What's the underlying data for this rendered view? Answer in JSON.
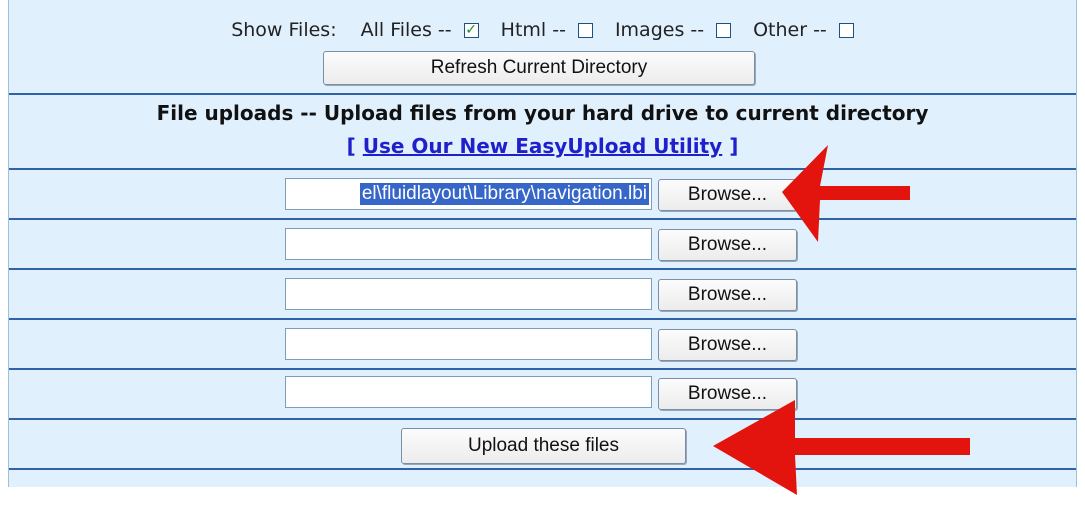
{
  "show_files": {
    "label": "Show Files:",
    "options": [
      {
        "label": "All Files --",
        "checked": true
      },
      {
        "label": "Html --",
        "checked": false
      },
      {
        "label": "Images --",
        "checked": false
      },
      {
        "label": "Other --",
        "checked": false
      }
    ],
    "check_mark": "✓"
  },
  "refresh_button": "Refresh Current Directory",
  "uploads": {
    "title": "File uploads -- Upload files from your hard drive to current directory",
    "link": {
      "open": "[ ",
      "text": "Use Our New EasyUpload Utility",
      "close": " ]"
    },
    "rows": [
      {
        "value": "el\\fluidlayout\\Library\\navigation.lbi",
        "browse": "Browse..."
      },
      {
        "value": "",
        "browse": "Browse..."
      },
      {
        "value": "",
        "browse": "Browse..."
      },
      {
        "value": "",
        "browse": "Browse..."
      },
      {
        "value": "",
        "browse": "Browse..."
      }
    ],
    "submit": "Upload these files"
  },
  "colors": {
    "panel": "#e1f0fd",
    "rule": "#2f62a8",
    "arrow": "#e3130e",
    "link": "#1f1fcc"
  }
}
